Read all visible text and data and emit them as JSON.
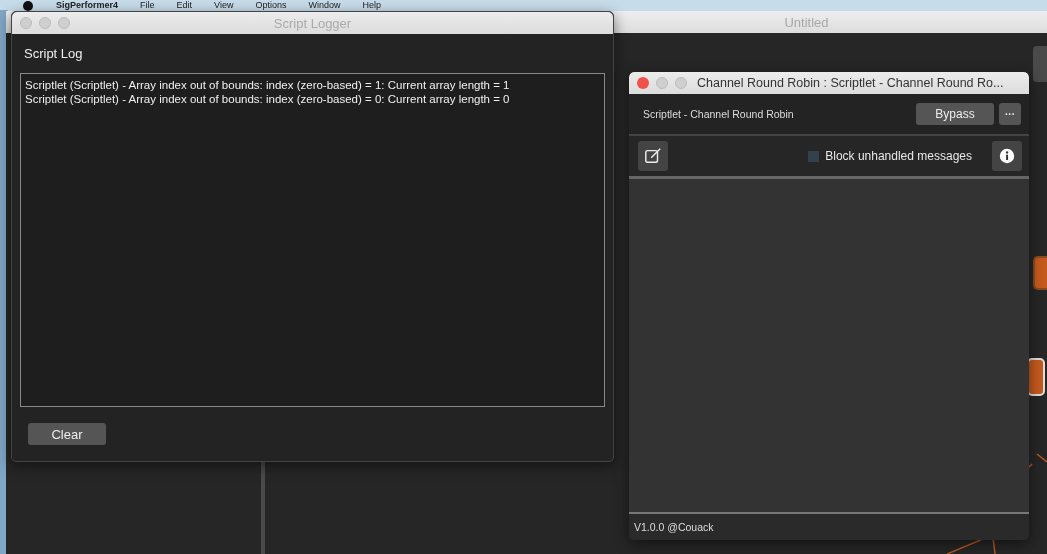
{
  "menu_bar": {
    "app_name": "SigPerformer4",
    "items": [
      "File",
      "Edit",
      "View",
      "Options",
      "Window",
      "Help"
    ]
  },
  "main_window": {
    "title": "Untitled"
  },
  "script_logger": {
    "title": "Script Logger",
    "heading": "Script Log",
    "log_lines": [
      "Scriptlet (Scriptlet) - Array index out of bounds: index (zero-based) = 1: Current array length = 1",
      "Scriptlet (Scriptlet) - Array index out of bounds: index (zero-based) = 0: Current array length = 0"
    ],
    "clear_button": "Clear"
  },
  "plugin_window": {
    "title": "Channel Round Robin : Scriptlet - Channel Round Ro...",
    "plugin_name": "Scriptlet - Channel Round Robin",
    "bypass_button": "Bypass",
    "more_button": "···",
    "block_unhandled": {
      "label": "Block unhandled messages",
      "checked": false
    },
    "footer": "V1.0.0 @Couack"
  }
}
